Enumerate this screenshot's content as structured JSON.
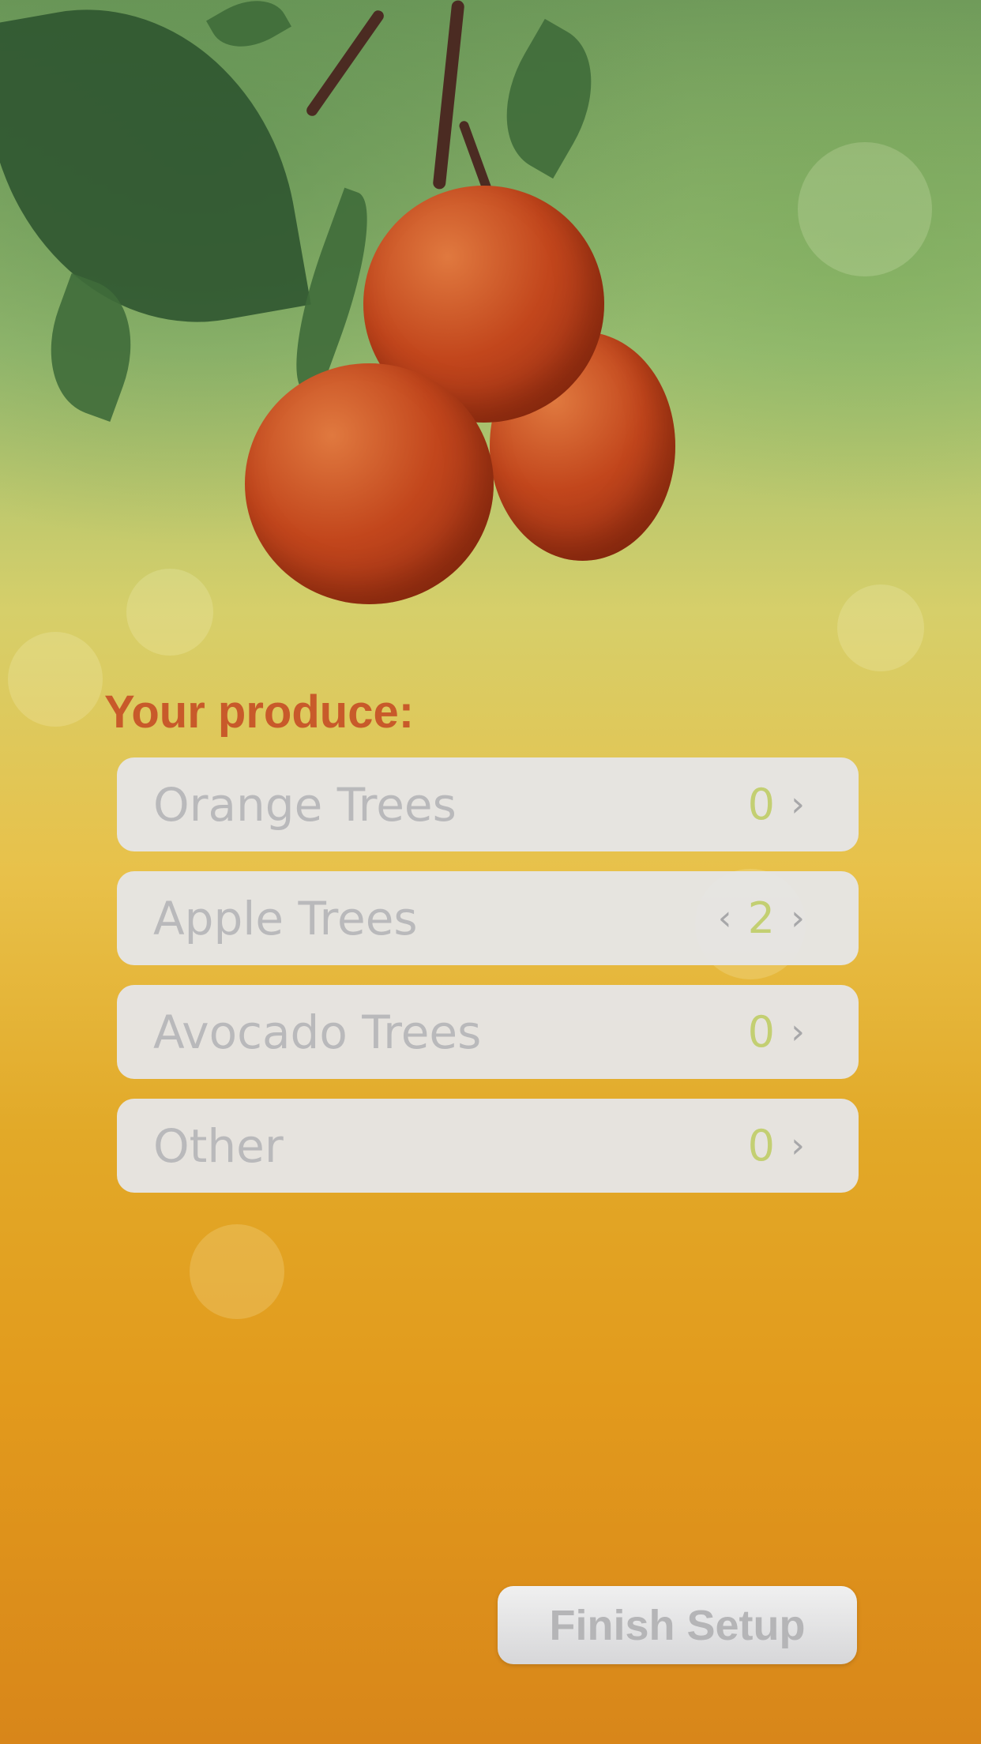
{
  "header": {
    "title": "Your produce:"
  },
  "produce": [
    {
      "label": "Orange Trees",
      "count": "0",
      "prev": "",
      "next": "›"
    },
    {
      "label": "Apple Trees",
      "count": "2",
      "prev": "‹",
      "next": "›"
    },
    {
      "label": "Avocado Trees",
      "count": "0",
      "prev": "",
      "next": "›"
    },
    {
      "label": "Other",
      "count": "0",
      "prev": "",
      "next": "›"
    }
  ],
  "footer": {
    "finish_label": "Finish Setup"
  },
  "colors": {
    "title": "#c85a2a",
    "count": "#c3cf72",
    "row_bg": "#e6e6e8",
    "label": "#b9b9bb"
  },
  "icons": {
    "decrement": "chevron-left-icon",
    "increment": "chevron-right-icon"
  }
}
